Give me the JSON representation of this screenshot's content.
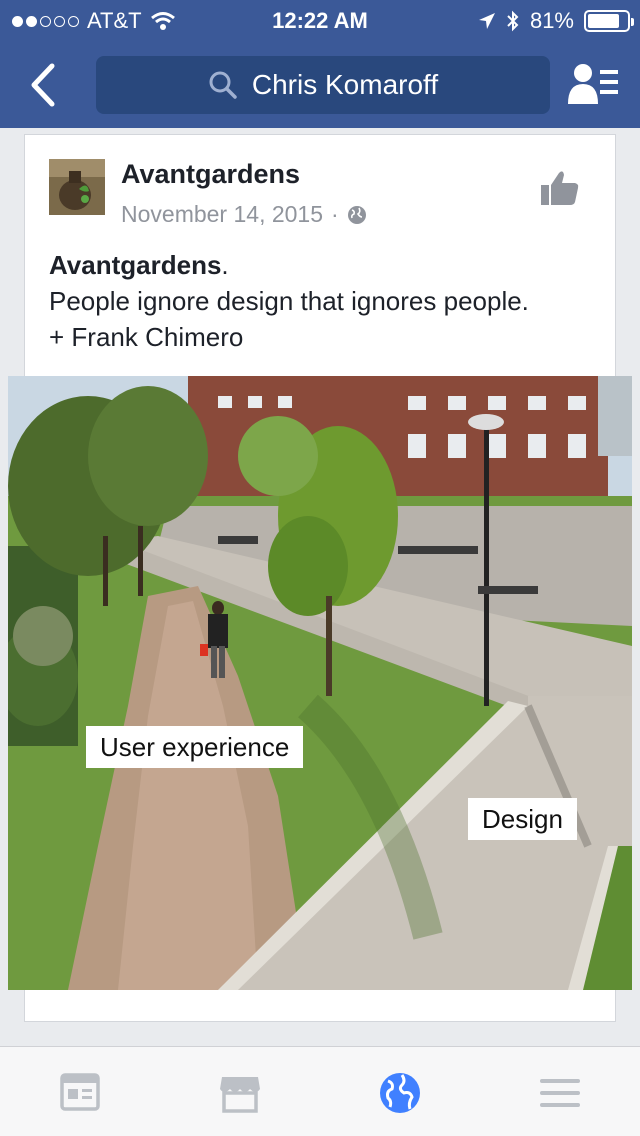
{
  "status_bar": {
    "carrier": "AT&T",
    "time": "12:22 AM",
    "battery": "81%",
    "battery_level": 0.81
  },
  "nav": {
    "search_text": "Chris Komaroff"
  },
  "post": {
    "author": "Avantgardens",
    "date": "November 14, 2015",
    "separator": "·",
    "body_title": "Avantgardens",
    "body_title_suffix": ".",
    "body_line1": "People ignore design that ignores people.",
    "body_line2": "+ Frank Chimero",
    "image_labels": {
      "user_experience": "User experience",
      "design": "Design"
    }
  },
  "colors": {
    "brand": "#3b5998",
    "search_bg": "#29487d",
    "active_tab": "#4080ff",
    "inactive_tab": "#bcc0c6"
  },
  "icons": [
    "back-icon",
    "search-icon",
    "friend-requests-icon",
    "like-icon",
    "globe-icon",
    "news-feed-icon",
    "marketplace-icon",
    "notifications-globe-icon",
    "menu-icon"
  ]
}
